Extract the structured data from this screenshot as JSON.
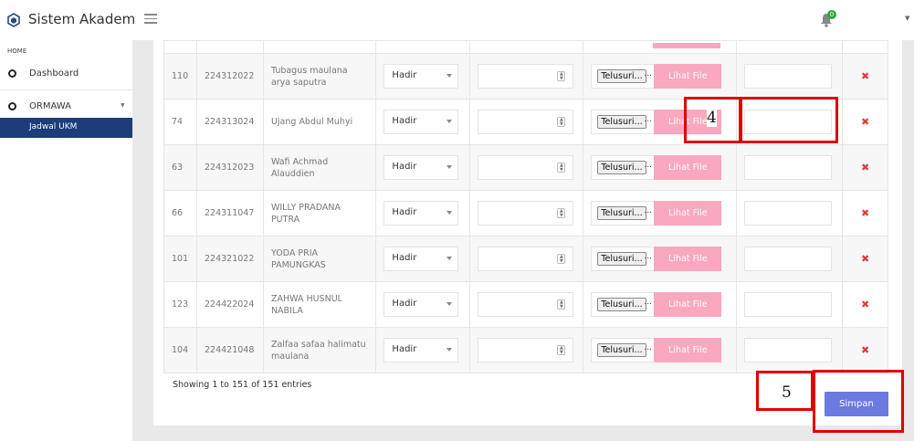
{
  "app": {
    "title": "Sistem Akademik",
    "notification_count": "0"
  },
  "sidebar": {
    "section_header": "HOME",
    "items": [
      {
        "label": "Dashboard"
      },
      {
        "label": "ORMAWA"
      }
    ],
    "active_sub_item": "Jadwal UKM"
  },
  "table": {
    "rows": [
      {
        "no": "110",
        "nim": "224312022",
        "name": "Tubagus maulana arya saputra",
        "status": "Hadir"
      },
      {
        "no": "74",
        "nim": "224313024",
        "name": "Ujang Abdul Muhyi",
        "status": "Hadir"
      },
      {
        "no": "63",
        "nim": "224312023",
        "name": "Wafi Achmad Alauddien",
        "status": "Hadir"
      },
      {
        "no": "66",
        "nim": "224311047",
        "name": "WILLY PRADANA PUTRA",
        "status": "Hadir"
      },
      {
        "no": "101",
        "nim": "224321022",
        "name": "YODA PRIA PAMUNGKAS",
        "status": "Hadir"
      },
      {
        "no": "123",
        "nim": "224422024",
        "name": "ZAHWA HUSNUL NABILA",
        "status": "Hadir"
      },
      {
        "no": "104",
        "nim": "224421048",
        "name": "Zalfaa safaa halimatu maulana",
        "status": "Hadir"
      }
    ],
    "browse_label": "Telusuri...",
    "file_placeholder": "...",
    "view_file_label": "Lihat File",
    "delete_glyph": "✖"
  },
  "footer": {
    "entries_info": "Showing 1 to 151 of 151 entries",
    "save_label": "Simpan"
  },
  "annotations": {
    "label_4": "4",
    "label_5": "5"
  }
}
